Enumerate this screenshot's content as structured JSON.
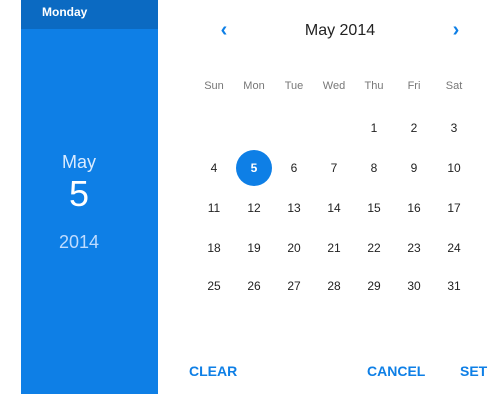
{
  "selected": {
    "weekday": "Monday",
    "month": "May",
    "day": "5",
    "year": "2014"
  },
  "header": {
    "title": "May 2014",
    "prev_icon": "chevron-left-icon",
    "next_icon": "chevron-right-icon"
  },
  "weekdays": [
    "Sun",
    "Mon",
    "Tue",
    "Wed",
    "Thu",
    "Fri",
    "Sat"
  ],
  "days": [
    "",
    "",
    "",
    "",
    "1",
    "2",
    "3",
    "4",
    "5",
    "6",
    "7",
    "8",
    "9",
    "10",
    "11",
    "12",
    "13",
    "14",
    "15",
    "16",
    "17",
    "18",
    "19",
    "20",
    "21",
    "22",
    "23",
    "24",
    "25",
    "26",
    "27",
    "28",
    "29",
    "30",
    "31"
  ],
  "actions": {
    "clear": "CLEAR",
    "cancel": "CANCEL",
    "set": "SET"
  },
  "colors": {
    "accent": "#0e7fe6",
    "panel_dark": "#0b6ac2"
  }
}
